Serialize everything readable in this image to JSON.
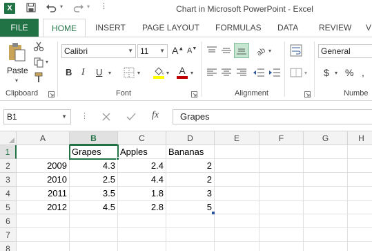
{
  "app": {
    "window_title": "Chart in Microsoft PowerPoint - Excel",
    "logo_letter": "X"
  },
  "tabs": [
    "FILE",
    "HOME",
    "INSERT",
    "PAGE LAYOUT",
    "FORMULAS",
    "DATA",
    "REVIEW",
    "V"
  ],
  "active_tab": "HOME",
  "ribbon": {
    "clipboard": {
      "paste_label": "Paste",
      "group_label": "Clipboard"
    },
    "font": {
      "name": "Calibri",
      "size": "11",
      "grow_label": "A",
      "shrink_label": "A",
      "bold": "B",
      "italic": "I",
      "underline": "U",
      "group_label": "Font",
      "fill_color": "#ffff00",
      "font_color": "#c00000"
    },
    "alignment": {
      "group_label": "Alignment"
    },
    "number": {
      "format": "General",
      "currency": "$",
      "percent": "%",
      "group_label": "Numbe"
    }
  },
  "formula_bar": {
    "name_box": "B1",
    "fx_label": "fx",
    "content": "Grapes"
  },
  "sheet": {
    "columns": [
      "A",
      "B",
      "C",
      "D",
      "E",
      "F",
      "G",
      "H"
    ],
    "rows": [
      "1",
      "2",
      "3",
      "4",
      "5",
      "6",
      "7",
      "8"
    ],
    "selected_column": "B",
    "selected_row": "1",
    "headers": [
      "",
      "Grapes",
      "Apples",
      "Bananas"
    ],
    "data": [
      [
        "2009",
        "4.3",
        "2.4",
        "2"
      ],
      [
        "2010",
        "2.5",
        "4.4",
        "2"
      ],
      [
        "2011",
        "3.5",
        "1.8",
        "3"
      ],
      [
        "2012",
        "4.5",
        "2.8",
        "5"
      ]
    ]
  },
  "colors": {
    "excel_green": "#217346"
  }
}
